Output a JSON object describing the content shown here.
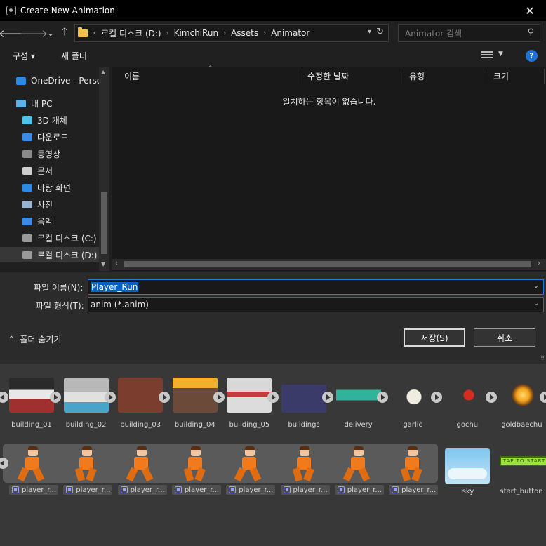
{
  "window": {
    "title": "Create New Animation",
    "close_glyph": "✕"
  },
  "nav": {
    "back_glyph": "🡐",
    "forward_glyph": "🡒",
    "recent_glyph": "⌄",
    "up_glyph": "🡑",
    "address": {
      "overflow": "«",
      "crumbs": [
        "로컬 디스크 (D:)",
        "KimchiRun",
        "Assets",
        "Animator"
      ],
      "sep": "›"
    },
    "search_placeholder": "Animator 검색"
  },
  "toolbar": {
    "organize": "구성 ▾",
    "new_folder": "새 폴더",
    "help": "?"
  },
  "sidebar": {
    "items": [
      {
        "label": "OneDrive - Personal",
        "icon": "onedrive-icon",
        "color": "#2b8ae6"
      },
      {
        "label": "내 PC",
        "icon": "pc-icon",
        "color": "#5fb0e8"
      },
      {
        "label": "3D 개체",
        "icon": "cube-icon",
        "color": "#4fc3e8"
      },
      {
        "label": "다운로드",
        "icon": "download-icon",
        "color": "#3b8be8"
      },
      {
        "label": "동영상",
        "icon": "video-icon",
        "color": "#8a8a8a"
      },
      {
        "label": "문서",
        "icon": "document-icon",
        "color": "#cfcfcf"
      },
      {
        "label": "바탕 화면",
        "icon": "desktop-icon",
        "color": "#2b8ae6"
      },
      {
        "label": "사진",
        "icon": "pictures-icon",
        "color": "#9ab4d0"
      },
      {
        "label": "음악",
        "icon": "music-icon",
        "color": "#3b8be8"
      },
      {
        "label": "로컬 디스크 (C:)",
        "icon": "drive-c-icon",
        "color": "#9a9a9a"
      },
      {
        "label": "로컬 디스크 (D:)",
        "icon": "drive-d-icon",
        "color": "#9a9a9a"
      }
    ]
  },
  "filelist": {
    "columns": [
      "이름",
      "수정한 날짜",
      "유형",
      "크기"
    ],
    "empty_message": "일치하는 항목이 없습니다."
  },
  "form": {
    "filename_label": "파일 이름(N):",
    "filename_value": "Player_Run",
    "filetype_label": "파일 형식(T):",
    "filetype_value": "anim (*.anim)",
    "hide_folders": "폴더 숨기기",
    "save": "저장(S)",
    "cancel": "취소"
  },
  "assets": {
    "row1": [
      "building_01",
      "building_02",
      "building_03",
      "building_04",
      "building_05",
      "buildings",
      "delivery",
      "garlic",
      "gochu",
      "goldbaechu"
    ],
    "player_frames": [
      "player_r...",
      "player_r...",
      "player_r...",
      "player_r...",
      "player_r...",
      "player_r...",
      "player_r...",
      "player_r..."
    ],
    "row2_extra": [
      "sky",
      "start_button"
    ],
    "start_button_text": "TAP TO START"
  }
}
